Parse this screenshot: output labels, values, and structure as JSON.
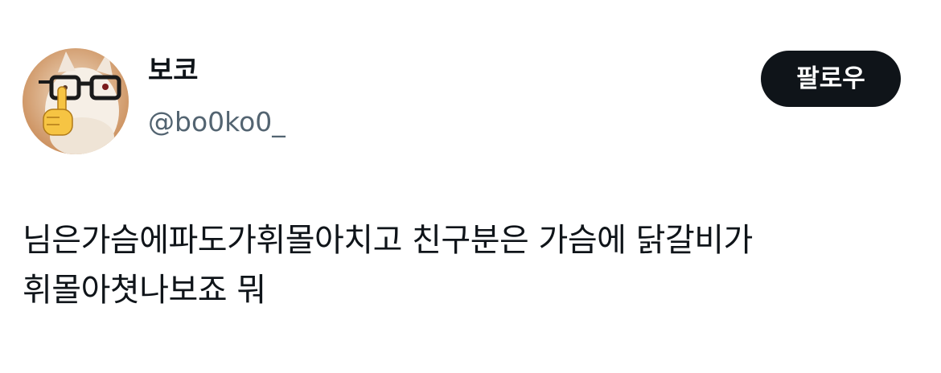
{
  "tweet": {
    "author": {
      "display_name": "보코",
      "handle": "@bo0ko0_",
      "avatar_icon": "avatar-photo-cat-with-glasses"
    },
    "follow_label": "팔로우",
    "text": "님은가슴에파도가휘몰아치고 친구분은 가슴에 닭갈비가\n휘몰아쳣나보죠 뭐"
  }
}
